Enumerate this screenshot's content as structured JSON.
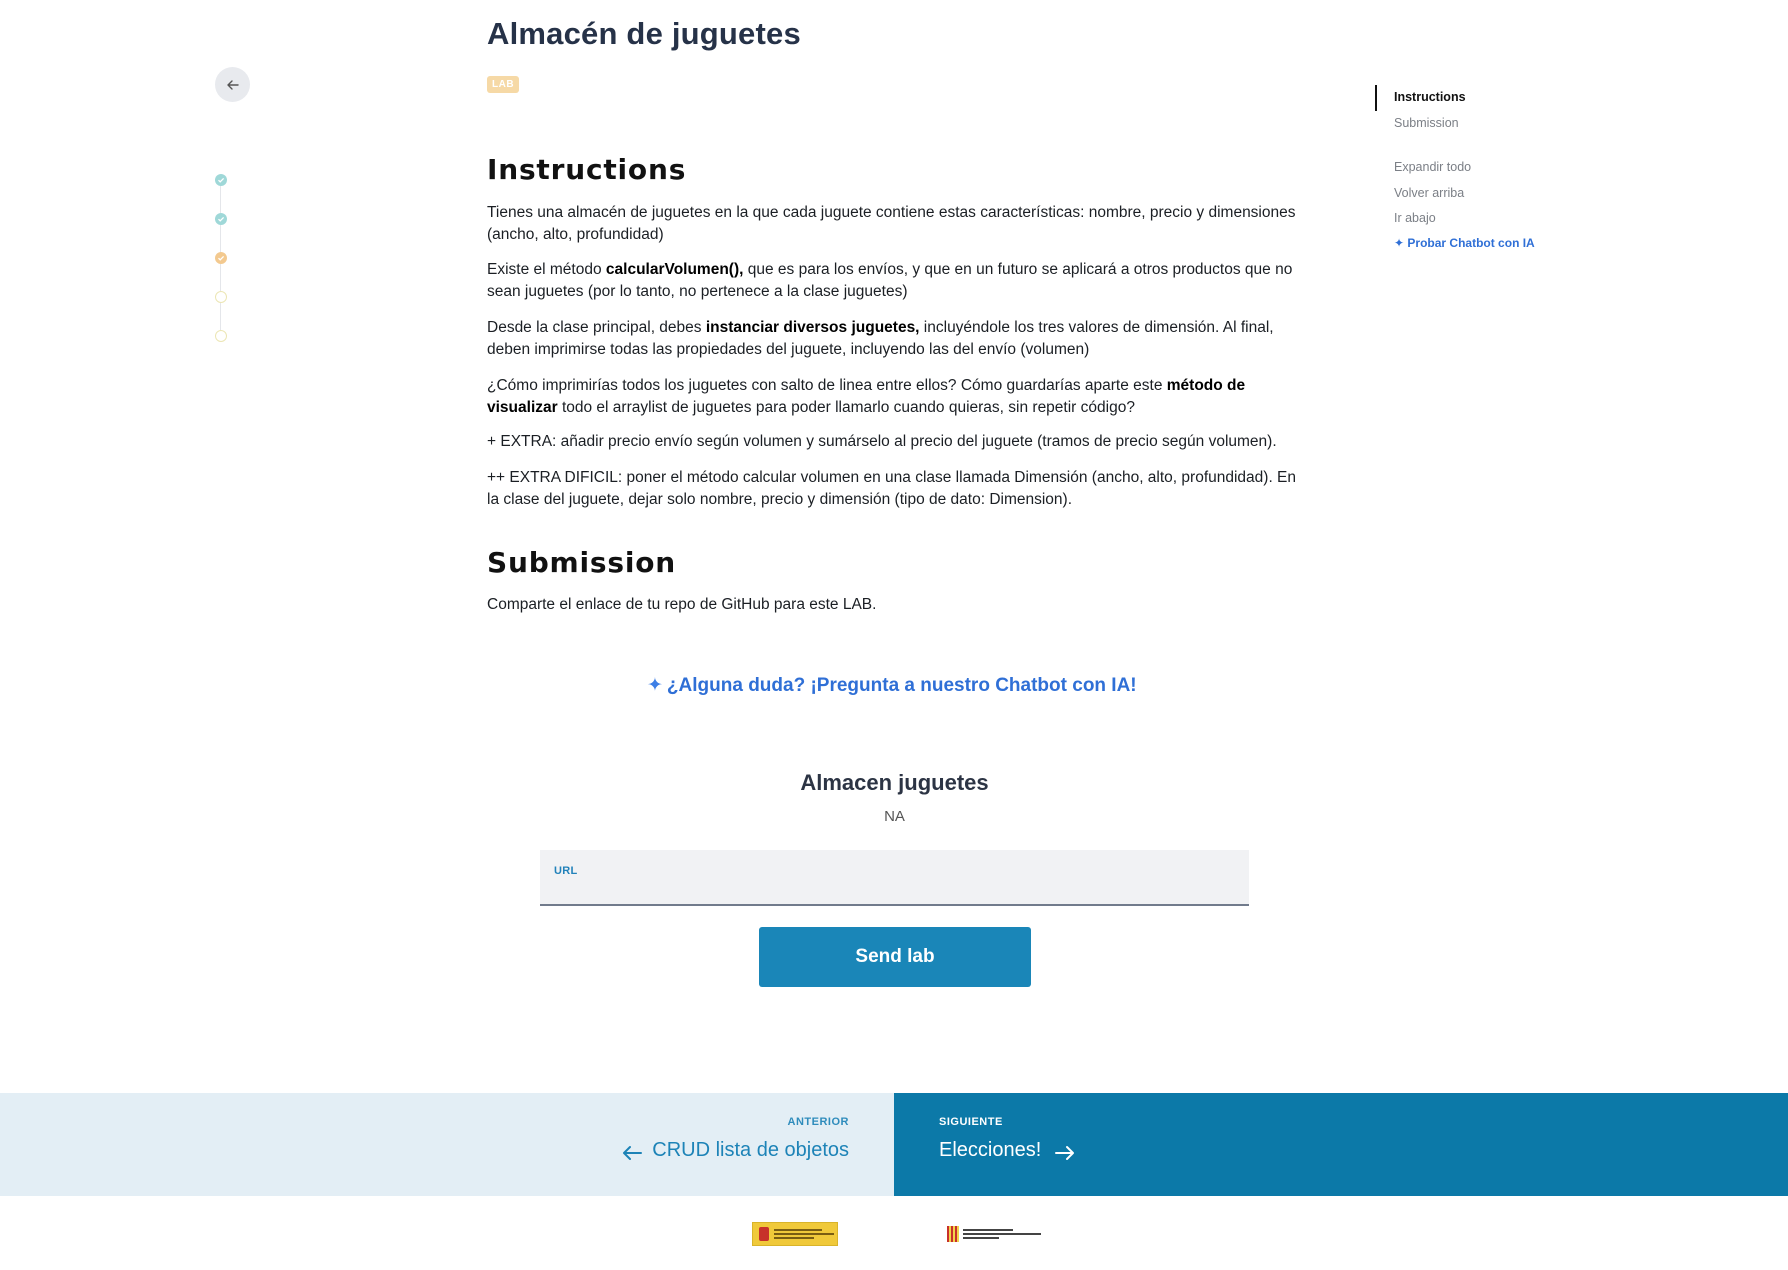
{
  "header": {
    "title": "Almacén de juguetes",
    "badge": "LAB"
  },
  "progress": {
    "steps": [
      "done",
      "done",
      "current",
      "todo",
      "todo"
    ]
  },
  "content": {
    "instructions_heading": "Instructions",
    "p1": "Tienes una almacén de juguetes en la que cada juguete contiene estas características: nombre, precio y dimensiones (ancho, alto, profundidad)",
    "p2_before": "Existe el método ",
    "p2_bold": "calcularVolumen(),",
    "p2_after": " que es para los envíos, y que en un futuro se aplicará a otros productos que no sean juguetes (por lo tanto, no pertenece a la clase juguetes)",
    "p3_before": "Desde la clase principal, debes ",
    "p3_bold": "instanciar diversos juguetes,",
    "p3_after": " incluyéndole los tres valores de dimensión. Al final, deben imprimirse todas las propiedades del juguete, incluyendo las del envío (volumen)",
    "p4_before": "¿Cómo imprimirías todos los juguetes con salto de linea entre ellos? Cómo guardarías aparte este ",
    "p4_bold": "método de visualizar",
    "p4_after": " todo el arraylist de juguetes para poder llamarlo cuando quieras, sin repetir código?",
    "p5": "+ EXTRA: añadir precio envío según volumen y sumárselo al precio del juguete (tramos de precio según volumen).",
    "p6": "++ EXTRA DIFICIL: poner el método calcular volumen en una clase llamada Dimensión (ancho, alto, profundidad). En la clase del juguete, dejar solo nombre, precio y dimensión (tipo de dato: Dimension).",
    "submission_heading": "Submission",
    "submission_text": "Comparte el enlace de tu repo de GitHub para este LAB."
  },
  "chatbot": {
    "label": "¿Alguna duda? ¡Pregunta a nuestro Chatbot con IA!"
  },
  "form": {
    "title": "Almacen juguetes",
    "status": "NA",
    "url_label": "URL",
    "url_value": "",
    "submit_label": "Send lab"
  },
  "toc": {
    "items": [
      "Instructions",
      "Submission"
    ],
    "expand_all": "Expandir todo",
    "back_to_top": "Volver arriba",
    "go_down": "Ir abajo",
    "ai_link": "Probar Chatbot con IA"
  },
  "bottom_nav": {
    "prev_kicker": "ANTERIOR",
    "prev_title": "CRUD lista de objetos",
    "next_kicker": "SIGUIENTE",
    "next_title": "Elecciones!"
  },
  "colors": {
    "accent": "#1a86b8",
    "next_bg": "#0c79a8",
    "prev_bg": "#e3eef5",
    "badge": "#f6d9a6"
  }
}
